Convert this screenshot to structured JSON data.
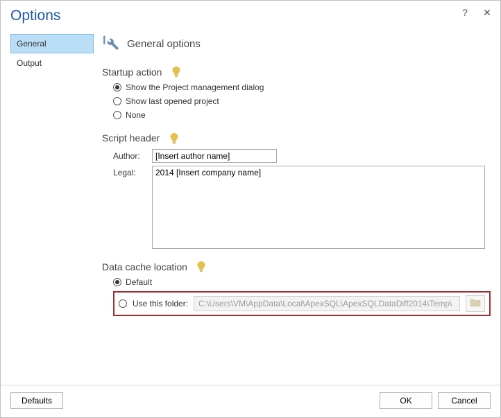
{
  "window": {
    "title": "Options",
    "help_icon": "?",
    "close_icon": "✕"
  },
  "sidebar": {
    "items": [
      {
        "label": "General",
        "selected": true
      },
      {
        "label": "Output",
        "selected": false
      }
    ]
  },
  "main": {
    "heading": "General options",
    "startup": {
      "title": "Startup action",
      "options": [
        {
          "label": "Show the Project management dialog",
          "selected": true
        },
        {
          "label": "Show last opened project",
          "selected": false
        },
        {
          "label": "None",
          "selected": false
        }
      ]
    },
    "script_header": {
      "title": "Script header",
      "author_label": "Author:",
      "author_value": "[Insert author name]",
      "legal_label": "Legal:",
      "legal_value": "2014 [Insert company name]"
    },
    "cache": {
      "title": "Data cache location",
      "default_label": "Default",
      "default_selected": true,
      "use_folder_label": "Use this folder:",
      "use_folder_selected": false,
      "path": "C:\\Users\\VM\\AppData\\Local\\ApexSQL\\ApexSQLDataDiff2014\\Temp\\"
    }
  },
  "footer": {
    "defaults": "Defaults",
    "ok": "OK",
    "cancel": "Cancel"
  }
}
